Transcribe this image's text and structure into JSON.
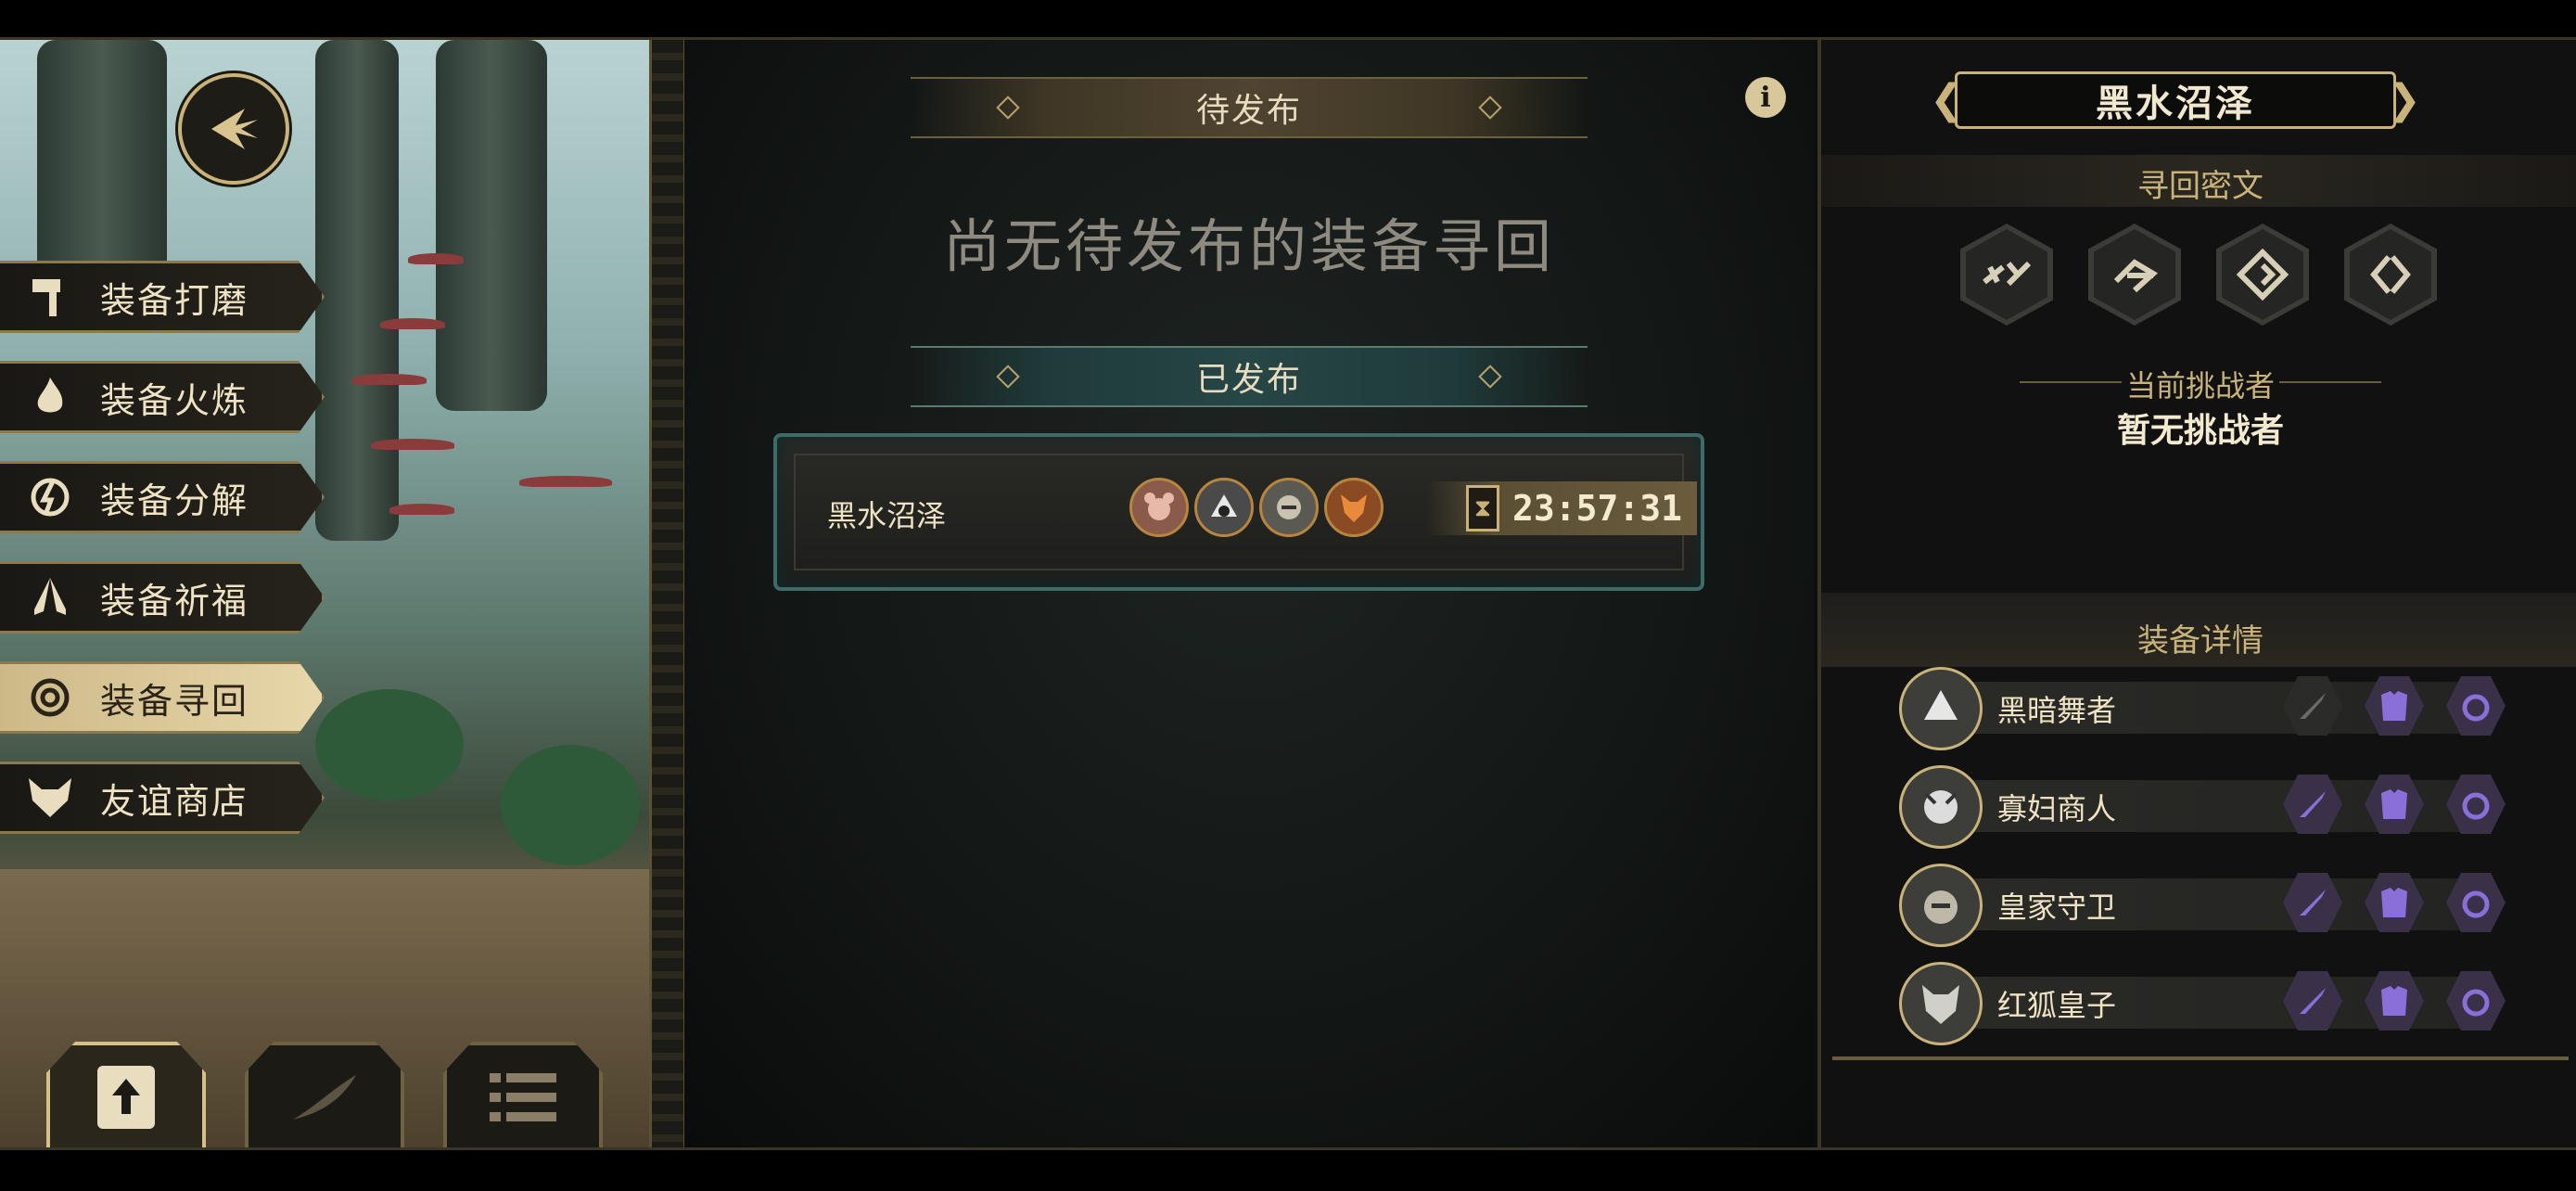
{
  "left_menu": {
    "items": [
      {
        "label": "装备打磨",
        "icon": "hammer-icon",
        "active": false
      },
      {
        "label": "装备火炼",
        "icon": "flame-icon",
        "active": false
      },
      {
        "label": "装备分解",
        "icon": "disassemble-icon",
        "active": false
      },
      {
        "label": "装备祈福",
        "icon": "pray-icon",
        "active": false
      },
      {
        "label": "装备寻回",
        "icon": "target-icon",
        "active": true
      },
      {
        "label": "友谊商店",
        "icon": "fox-icon",
        "active": false
      }
    ]
  },
  "bottom_tabs": [
    {
      "icon": "upload-icon",
      "active": true
    },
    {
      "icon": "feather-icon",
      "active": false
    },
    {
      "icon": "list-icon",
      "active": false
    }
  ],
  "center": {
    "pending_title": "待发布",
    "pending_empty": "尚无待发布的装备寻回",
    "published_title": "已发布",
    "published_quest": {
      "name": "黑水沼泽",
      "timer": "23:57:31"
    }
  },
  "right_panel": {
    "title": "黑水沼泽",
    "runes_title": "寻回密文",
    "challenger_label": "当前挑战者",
    "challenger_value": "暂无挑战者",
    "equip_title": "装备详情",
    "equipment": [
      {
        "name": "黑暗舞者",
        "slots": [
          false,
          true,
          true
        ]
      },
      {
        "name": "寡妇商人",
        "slots": [
          true,
          true,
          true
        ]
      },
      {
        "name": "皇家守卫",
        "slots": [
          true,
          true,
          true
        ]
      },
      {
        "name": "红狐皇子",
        "slots": [
          true,
          true,
          true
        ]
      }
    ]
  },
  "colors": {
    "gold": "#c9b37a",
    "teal": "#3f6a6a",
    "purple": "#7b62c9"
  }
}
